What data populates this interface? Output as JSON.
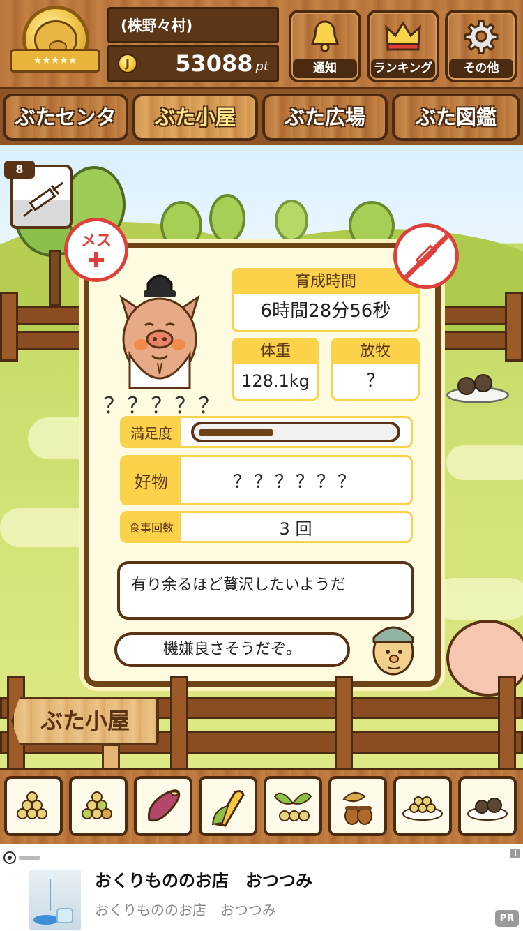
{
  "header": {
    "village_name": "(株野々村)",
    "points_value": "53088",
    "points_unit": "pt",
    "coin_icon": "coin-icon",
    "buttons": [
      {
        "label": "通知",
        "icon": "bell-icon"
      },
      {
        "label": "ランキング",
        "icon": "crown-icon"
      },
      {
        "label": "その他",
        "icon": "gear-icon"
      }
    ]
  },
  "tabs": [
    {
      "label": "ぶたセンター",
      "active": false
    },
    {
      "label": "ぶた小屋",
      "active": true
    },
    {
      "label": "ぶた広場",
      "active": false
    },
    {
      "label": "ぶた図鑑",
      "active": false
    }
  ],
  "syringe": {
    "count": "8",
    "icon": "syringe-icon"
  },
  "pig": {
    "gender_label": "メス",
    "name": "？？？？？",
    "growth_time_label": "育成時間",
    "growth_time_value": "6時間28分56秒",
    "weight_label": "体重",
    "weight_value": "128.1kg",
    "grazing_label": "放牧",
    "grazing_value": "？",
    "satisfaction_label": "満足度",
    "satisfaction_level": 0.38,
    "favorite_label": "好物",
    "favorite_value": "？？？？？？",
    "meals_label": "食事回数",
    "meals_value": "3 回"
  },
  "messages": {
    "pig_thought": "有り余るほど贅沢したいようだ",
    "farmer_comment": "機嫌良さそうだぞ。"
  },
  "sign_label": "ぶた小屋",
  "food_tray": [
    {
      "icon": "yellow-beans-icon"
    },
    {
      "icon": "mixed-beans-icon"
    },
    {
      "icon": "sweet-potato-icon"
    },
    {
      "icon": "corn-icon"
    },
    {
      "icon": "seeds-icon"
    },
    {
      "icon": "acorn-icon"
    },
    {
      "icon": "bean-plate-icon"
    },
    {
      "icon": "truffle-plate-icon"
    }
  ],
  "ad": {
    "title": "おくりもののお店　おつつみ",
    "subtitle": "おくりもののお店　おつつみ",
    "pr_label": "PR",
    "info_label": "i"
  },
  "colors": {
    "wood": "#b8743a",
    "dark_brown": "#5a3315",
    "card_bg": "#fffce1",
    "label_yellow": "#fbd24a",
    "badge_red": "#e0403a"
  }
}
